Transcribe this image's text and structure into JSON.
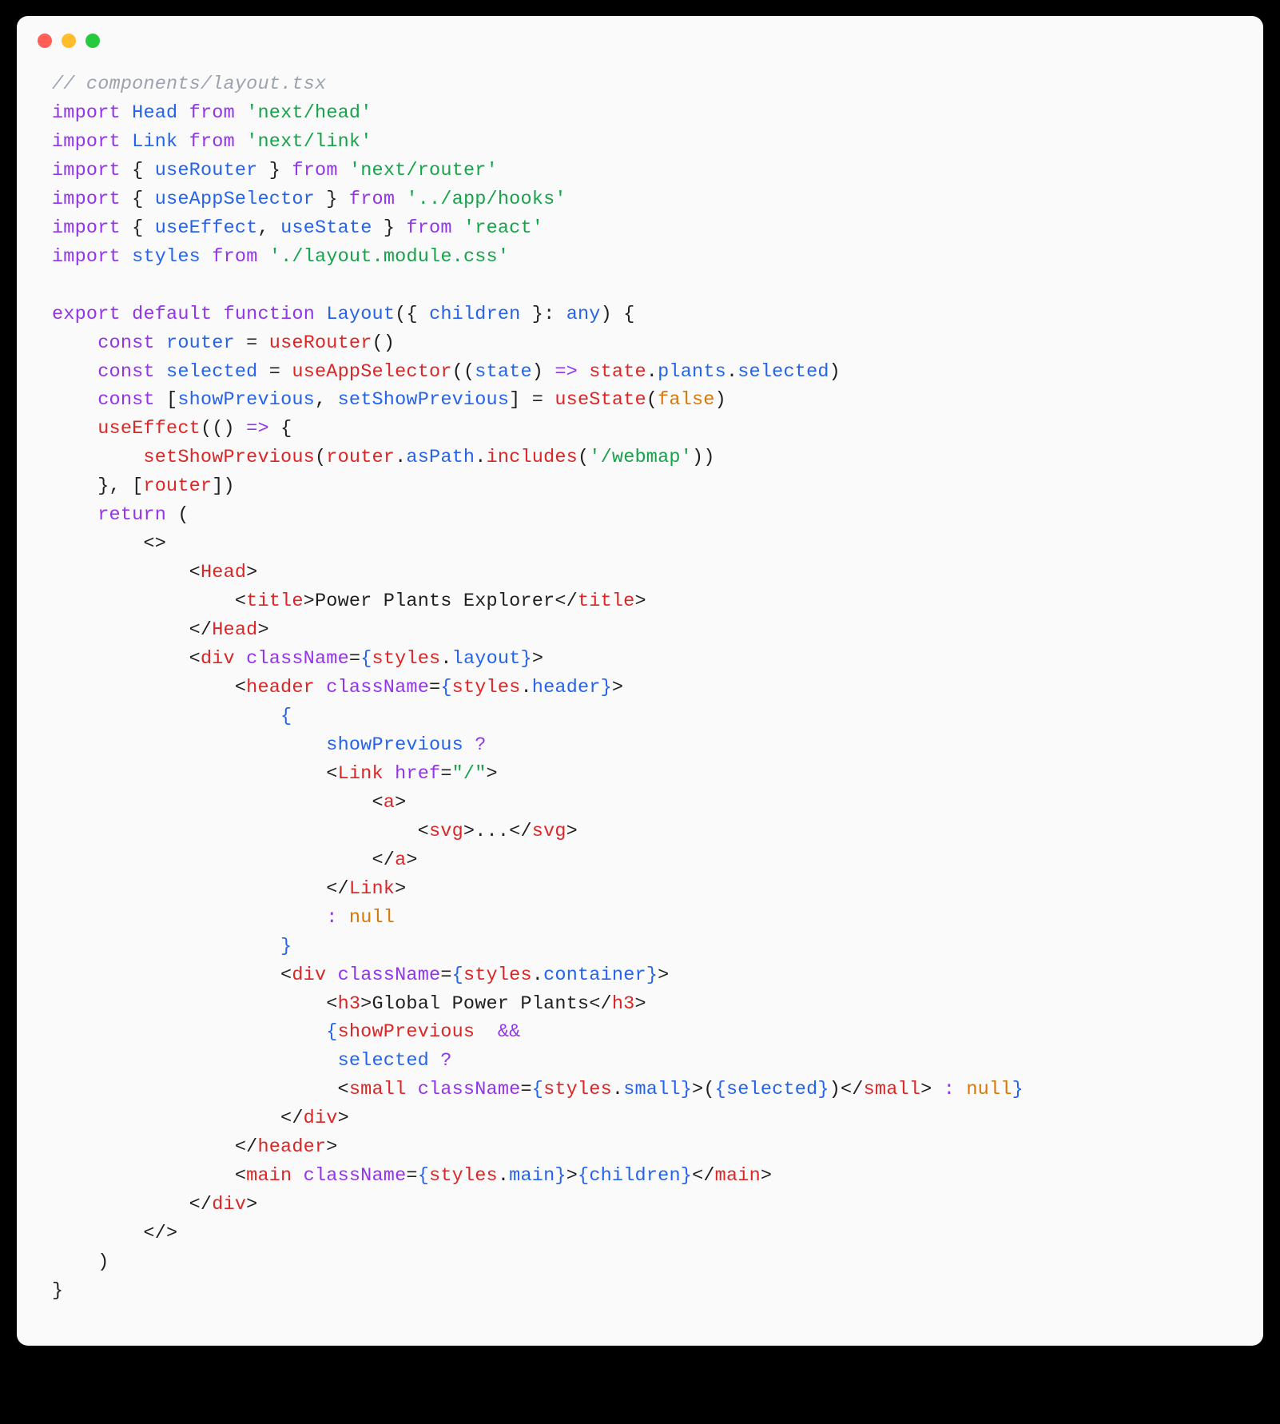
{
  "filename_comment": "// components/layout.tsx",
  "lines": {
    "l1": {
      "kw1": "import",
      "id": "Head",
      "kw2": "from",
      "str": "'next/head'"
    },
    "l2": {
      "kw1": "import",
      "id": "Link",
      "kw2": "from",
      "str": "'next/link'"
    },
    "l3": {
      "kw1": "import",
      "id": "useRouter",
      "kw2": "from",
      "str": "'next/router'"
    },
    "l4": {
      "kw1": "import",
      "id": "useAppSelector",
      "kw2": "from",
      "str": "'../app/hooks'"
    },
    "l5": {
      "kw1": "import",
      "id1": "useEffect",
      "id2": "useState",
      "kw2": "from",
      "str": "'react'"
    },
    "l6": {
      "kw1": "import",
      "id": "styles",
      "kw2": "from",
      "str": "'./layout.module.css'"
    },
    "fn": {
      "export": "export",
      "default": "default",
      "function": "function",
      "name": "Layout",
      "param": "children",
      "type": "any"
    },
    "b1": {
      "const": "const",
      "id": "router",
      "fn": "useRouter"
    },
    "b2": {
      "const": "const",
      "id": "selected",
      "fn": "useAppSelector",
      "arg": "state",
      "arrow": "=>",
      "s1": "state",
      "p1": "plants",
      "p2": "selected"
    },
    "b3": {
      "const": "const",
      "id1": "showPrevious",
      "id2": "setShowPrevious",
      "fn": "useState",
      "val": "false"
    },
    "b4": {
      "fn": "useEffect",
      "arrow": "=>",
      "inner": "setShowPrevious",
      "r": "router",
      "as": "asPath",
      "inc": "includes",
      "arg": "'/webmap'",
      "dep": "router"
    },
    "ret": "return",
    "jsx": {
      "head": "Head",
      "title": "title",
      "title_text": "Power Plants Explorer",
      "div": "div",
      "className": "className",
      "styles": "styles",
      "layout": "layout",
      "header": "header",
      "header_prop": "header",
      "showPrevious": "showPrevious",
      "q": "?",
      "Link": "Link",
      "href": "href",
      "href_val": "\"/\"",
      "a": "a",
      "svg": "svg",
      "dots": "...",
      "colon": ":",
      "null": "null",
      "container": "container",
      "h3": "h3",
      "h3_text": "Global Power Plants",
      "amp": "&&",
      "selected": "selected",
      "small": "small",
      "small_prop": "small",
      "main": "main",
      "main_prop": "main",
      "children": "children"
    }
  }
}
